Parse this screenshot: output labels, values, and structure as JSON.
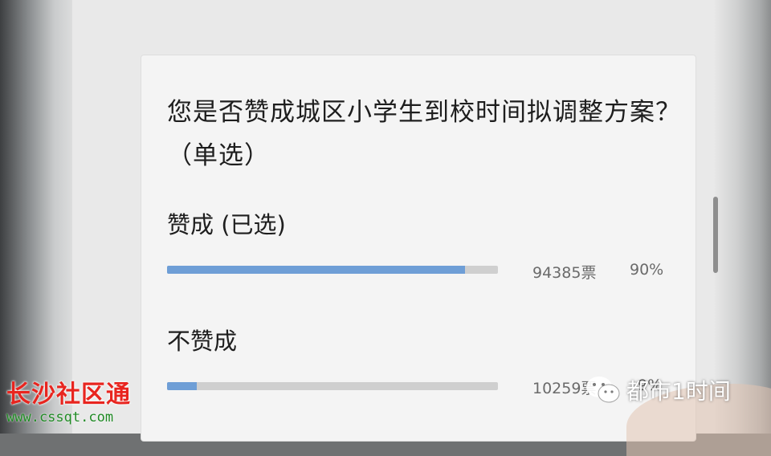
{
  "poll": {
    "question": "您是否赞成城区小学生到校时间拟调整方案？（单选）",
    "options": [
      {
        "label": "赞成 (已选)",
        "votes": "94385票",
        "percent": "90%",
        "fraction": 0.9
      },
      {
        "label": "不赞成",
        "votes": "10259票",
        "percent": "9%",
        "fraction": 0.09
      }
    ]
  },
  "watermarks": {
    "site_name": "长沙社区通",
    "site_url": "www.cssqt.com",
    "channel_name": "都市1时间",
    "channel_icon": "wechat-icon"
  },
  "colors": {
    "bar_fill": "#6e9ed6",
    "bar_track": "#cfcfcf",
    "site_name": "#e8251f",
    "site_url": "#1f8a24"
  }
}
